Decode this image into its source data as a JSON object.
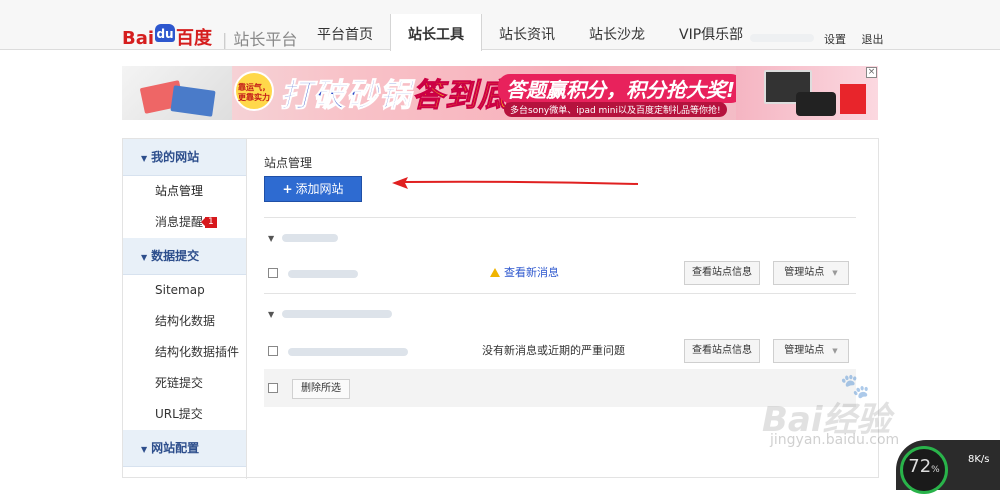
{
  "header": {
    "logo_bai": "Bai",
    "logo_du": "du",
    "logo_zh": "百度",
    "platform": "站长平台",
    "nav": [
      "平台首页",
      "站长工具",
      "站长资讯",
      "站长沙龙",
      "VIP俱乐部"
    ],
    "active_nav": "站长工具",
    "links": {
      "settings": "设置",
      "logout": "退出"
    }
  },
  "banner": {
    "tag": "靠运气，更靠实力",
    "title_a": "打破砂锅",
    "title_b": "答到底",
    "slogan": "答题赢积分，积分抢大奖!",
    "sub": "多台sony微单、ipad mini以及百度定制礼品等你抢!",
    "close": "×"
  },
  "sidebar": {
    "groups": [
      {
        "label": "我的网站",
        "items": [
          {
            "label": "站点管理"
          },
          {
            "label": "消息提醒",
            "badge": "1"
          }
        ]
      },
      {
        "label": "数据提交",
        "items": [
          {
            "label": "Sitemap"
          },
          {
            "label": "结构化数据"
          },
          {
            "label": "结构化数据插件"
          },
          {
            "label": "死链提交"
          },
          {
            "label": "URL提交"
          }
        ]
      },
      {
        "label": "网站配置",
        "items": []
      }
    ]
  },
  "main": {
    "title": "站点管理",
    "add_button": "添加网站",
    "sites": [
      {
        "status": "查看新消息",
        "status_type": "warning",
        "view_btn": "查看站点信息",
        "manage_btn": "管理站点"
      },
      {
        "status": "没有新消息或近期的严重问题",
        "status_type": "ok",
        "view_btn": "查看站点信息",
        "manage_btn": "管理站点"
      }
    ],
    "delete_selected": "删除所选"
  },
  "watermark": {
    "text": "Bai经验",
    "url": "jingyan.baidu.com"
  },
  "speed_widget": {
    "percent": "72",
    "percent_unit": "%",
    "rate": "8K/s"
  },
  "colors": {
    "accent": "#2e6bd1",
    "arrow": "#e02020",
    "sidebar_group_bg": "#e8f0f8"
  }
}
